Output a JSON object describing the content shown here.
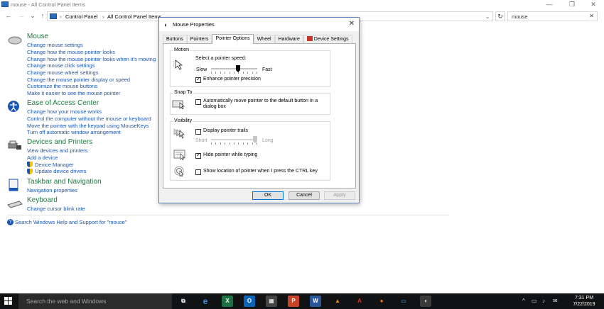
{
  "window": {
    "title": "mouse - All Control Panel Items",
    "controls": {
      "minimize": "—",
      "maximize": "❐",
      "close": "✕"
    }
  },
  "address": {
    "back": "←",
    "forward": "→",
    "recent": "⌄",
    "up": "↑",
    "breadcrumbs": [
      "Control Panel",
      "All Control Panel Items"
    ],
    "separator": "›",
    "dropdown": "⌄",
    "refresh": "↻",
    "search_value": "mouse",
    "search_clear": "✕"
  },
  "categories": [
    {
      "title": "Mouse",
      "links": [
        "Change mouse settings",
        "Change how the mouse pointer looks",
        "Change how the mouse pointer looks when it's moving",
        "Change mouse click settings",
        "Change mouse wheel settings",
        "Change the mouse pointer display or speed",
        "Customize the mouse buttons",
        "Make it easier to see the mouse pointer"
      ]
    },
    {
      "title": "Ease of Access Center",
      "links": [
        "Change how your mouse works",
        "Control the computer without the mouse or keyboard",
        "Move the pointer with the keypad using MouseKeys",
        "Turn off automatic window arrangement"
      ]
    },
    {
      "title": "Devices and Printers",
      "links": [
        "View devices and printers",
        "Add a device",
        "Device Manager",
        "Update device drivers"
      ]
    },
    {
      "title": "Taskbar and Navigation",
      "links": [
        "Navigation properties"
      ]
    },
    {
      "title": "Keyboard",
      "links": [
        "Change cursor blink rate"
      ]
    }
  ],
  "help_link": "Search Windows Help and Support for \"mouse\"",
  "dialog": {
    "title": "Mouse Properties",
    "close": "✕",
    "tabs": [
      "Buttons",
      "Pointers",
      "Pointer Options",
      "Wheel",
      "Hardware",
      "Device Settings"
    ],
    "active_tab": "Pointer Options",
    "motion": {
      "label": "Motion",
      "speed_label": "Select a pointer speed:",
      "slow": "Slow",
      "fast": "Fast",
      "speed_value": 0.6,
      "enhance_precision": "Enhance pointer precision",
      "enhance_checked": true
    },
    "snap_to": {
      "label": "Snap To",
      "auto_move": "Automatically move pointer to the default button in a dialog box",
      "auto_move_checked": false
    },
    "visibility": {
      "label": "Visibility",
      "trails": "Display pointer trails",
      "trails_checked": false,
      "short": "Short",
      "long": "Long",
      "trails_value": 1.0,
      "hide_typing": "Hide pointer while typing",
      "hide_typing_checked": true,
      "show_ctrl": "Show location of pointer when I press the CTRL key",
      "show_ctrl_checked": false
    },
    "buttons": {
      "ok": "OK",
      "cancel": "Cancel",
      "apply": "Apply"
    }
  },
  "taskbar": {
    "search_placeholder": "Search the web and Windows",
    "apps": [
      {
        "name": "task-view",
        "label": "⧉",
        "color": "#111214"
      },
      {
        "name": "edge",
        "label": "e",
        "color": "#1a73c8"
      },
      {
        "name": "excel",
        "label": "X",
        "color": "#1d7044"
      },
      {
        "name": "outlook",
        "label": "O",
        "color": "#0a64b4"
      },
      {
        "name": "calculator",
        "label": "▦",
        "color": "#444444"
      },
      {
        "name": "powerpoint",
        "label": "P",
        "color": "#c6452a"
      },
      {
        "name": "word",
        "label": "W",
        "color": "#2a5699"
      },
      {
        "name": "vlc",
        "label": "▲",
        "color": "#111214"
      },
      {
        "name": "acrobat",
        "label": "A",
        "color": "#111214"
      },
      {
        "name": "firefox",
        "label": "●",
        "color": "#111214"
      },
      {
        "name": "control-panel",
        "label": "▭",
        "color": "#111214"
      },
      {
        "name": "mouse-properties",
        "label": "◖",
        "color": "#3b3b3b"
      }
    ],
    "tray_icons": [
      "^",
      "▭",
      "♪",
      "✉"
    ],
    "time": "7:31 PM",
    "date": "7/22/2019"
  }
}
